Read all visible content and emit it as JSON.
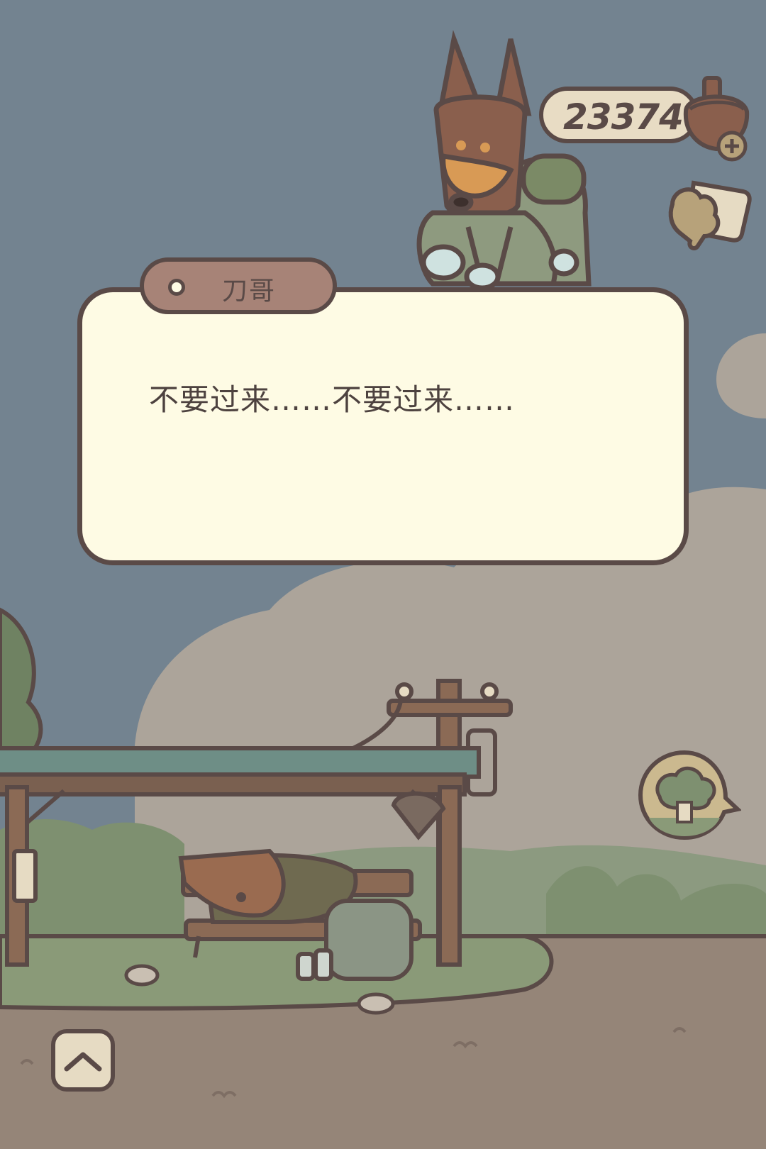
{
  "dialog": {
    "speaker": "刀哥",
    "text": "不要过来……不要过来……"
  },
  "hud": {
    "currency_amount": "23374",
    "currency_icon": "acorn-icon",
    "add_icon": "plus-icon",
    "map_icon": "map-icon",
    "home_icon": "tree-house-icon",
    "up_icon": "chevron-up-icon"
  },
  "colors": {
    "sky": "#738390",
    "cloud": "#aca49a",
    "ground": "#958578",
    "grass": "#8a9a78",
    "dialog_bg": "#fefbe4",
    "speaker_tab": "#a78377",
    "outline": "#5a4a47"
  }
}
